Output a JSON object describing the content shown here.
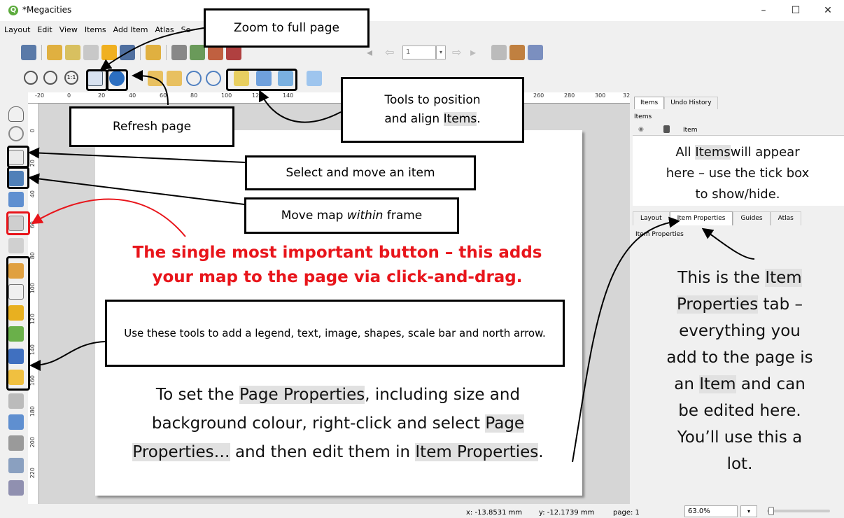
{
  "window": {
    "title": "*Megacities",
    "controls": [
      "–",
      "☐",
      "✕"
    ]
  },
  "menu": [
    "Layout",
    "Edit",
    "View",
    "Items",
    "Add Item",
    "Atlas",
    "Se"
  ],
  "toolbar": {
    "page_number": "1"
  },
  "ruler": {
    "h_ticks": [
      "-20",
      "0",
      "20",
      "40",
      "60",
      "80",
      "100",
      "120",
      "140",
      "260",
      "280",
      "300",
      "320"
    ],
    "v_ticks": [
      "0",
      "20",
      "40",
      "60",
      "80",
      "100",
      "120",
      "140",
      "160",
      "180",
      "200",
      "220"
    ]
  },
  "callouts": {
    "zoom_full": "Zoom to full page",
    "refresh": "Refresh page",
    "position_align_1": "Tools to position",
    "position_align_2": "and align",
    "position_align_items": "Items",
    "position_align_end": ".",
    "select_move": "Select and move an item",
    "move_map": "Move map",
    "move_map_within": "within",
    "move_map_end": "frame",
    "important_1": "The single most important button – this adds",
    "important_2": "your map to the page via click-and-drag.",
    "add_tools": "Use these tools to add a legend, text, image, shapes, scale bar and north arrow.",
    "page_props_1": "To set the",
    "page_props_hl1": "Page Properties",
    "page_props_2": ", including size and",
    "page_props_3": "background colour, right-click and select",
    "page_props_hl2a": "Page",
    "page_props_hl2b": "Properties…",
    "page_props_4": "and then edit them in",
    "page_props_hl3": "Item Properties",
    "page_props_end": ".",
    "items_all": "All",
    "items_hl": "Items",
    "items_rest1": "will appear",
    "items_rest2": "here – use the tick box",
    "items_rest3": "to show/hide.",
    "ip_1": "This is the",
    "ip_hl1a": "Item",
    "ip_hl1b": "Properties",
    "ip_2": "tab –",
    "ip_3": "everything you",
    "ip_4": "add to the page is",
    "ip_5": "an",
    "ip_hl2": "Item",
    "ip_6": "and can",
    "ip_7": "be edited here.",
    "ip_8": "You’ll use this a",
    "ip_9": "lot."
  },
  "panel": {
    "tabs_top": [
      "Items",
      "Undo History"
    ],
    "items_title": "Items",
    "items_col": "Item",
    "tabs_bottom": [
      "Layout",
      "Item Properties",
      "Guides",
      "Atlas"
    ],
    "ip_title": "Item Properties"
  },
  "status": {
    "x": "x: -13.8531 mm",
    "y": "y: -12.1739 mm",
    "page": "page: 1",
    "zoom": "63.0%"
  },
  "colors": {
    "red": "#e8151b",
    "highlight": "#e1e1e1",
    "qgis_green": "#5cab3c"
  }
}
